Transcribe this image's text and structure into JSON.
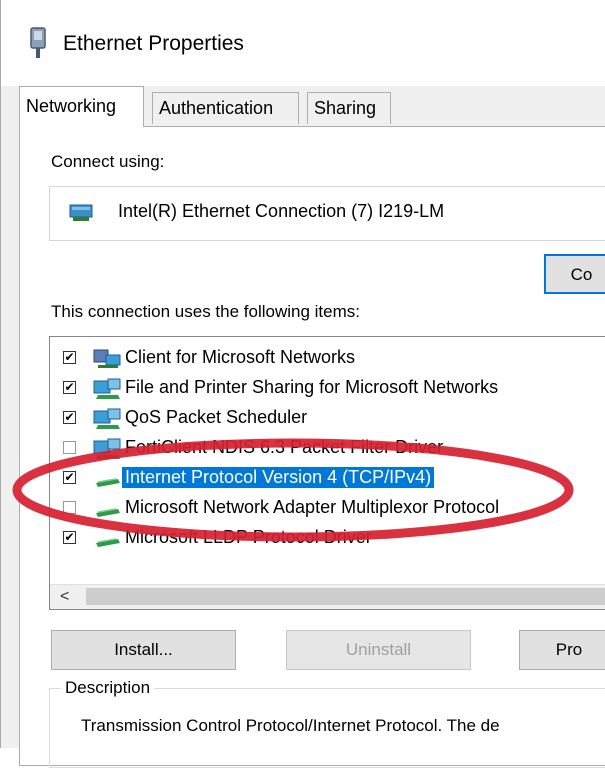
{
  "window": {
    "title": "Ethernet Properties",
    "icon": "network-adapter-icon"
  },
  "tabs": [
    {
      "label": "Networking",
      "active": true
    },
    {
      "label": "Authentication",
      "active": false
    },
    {
      "label": "Sharing",
      "active": false
    }
  ],
  "networking": {
    "connect_using_label": "Connect using:",
    "adapter_name": "Intel(R) Ethernet Connection (7) I219-LM",
    "configure_button": "Co",
    "items_label": "This connection uses the following items:",
    "items": [
      {
        "label": "Client for Microsoft Networks",
        "checked": true,
        "icon": "network-client-icon",
        "selected": false
      },
      {
        "label": "File and Printer Sharing for Microsoft Networks",
        "checked": true,
        "icon": "network-service-icon",
        "selected": false
      },
      {
        "label": "QoS Packet Scheduler",
        "checked": true,
        "icon": "network-service-icon",
        "selected": false
      },
      {
        "label": "FortiClient NDIS 6.3 Packet Filter Driver",
        "checked": false,
        "icon": "network-service-icon",
        "selected": false
      },
      {
        "label": "Internet Protocol Version 4 (TCP/IPv4)",
        "checked": true,
        "icon": "network-protocol-icon",
        "selected": true
      },
      {
        "label": "Microsoft Network Adapter Multiplexor Protocol",
        "checked": false,
        "icon": "network-protocol-icon",
        "selected": false
      },
      {
        "label": "Microsoft LLDP Protocol Driver",
        "checked": true,
        "icon": "network-protocol-icon",
        "selected": false
      }
    ],
    "install_button": "Install...",
    "uninstall_button": "Uninstall",
    "properties_button": "Pro",
    "description_label": "Description",
    "description_text": "Transmission Control Protocol/Internet Protocol. The de"
  },
  "colors": {
    "selection": "#0078d7",
    "annotation_ring": "#d62030"
  }
}
